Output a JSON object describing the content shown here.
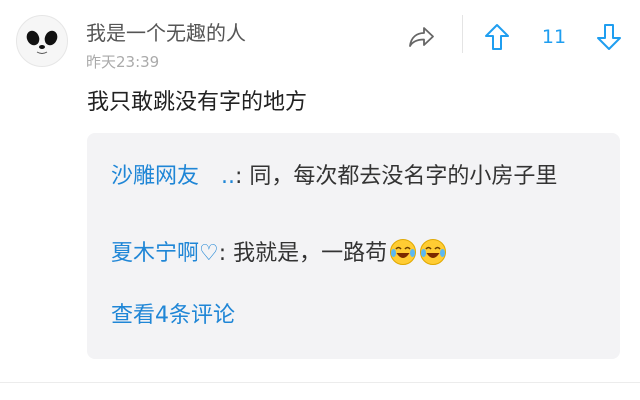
{
  "comment": {
    "username": "我是一个无趣的人",
    "timestamp": "昨天23:39",
    "vote_count": "11",
    "text": "我只敢跳没有字的地方",
    "icons": {
      "avatar": "panda-avatar",
      "share": "share-icon",
      "upvote": "arrow-up-icon",
      "downvote": "arrow-down-icon"
    }
  },
  "replies": [
    {
      "author": "沙雕网友　..",
      "text": ": 同，每次都去没名字的小房子里"
    },
    {
      "author": "夏木宁啊♡",
      "text": ": 我就是，一路苟"
    }
  ],
  "view_more_label": "查看4条评论",
  "colors": {
    "accent": "#1f86d6",
    "vote": "#1f9ef0",
    "reply_bg": "#f3f3f5"
  }
}
